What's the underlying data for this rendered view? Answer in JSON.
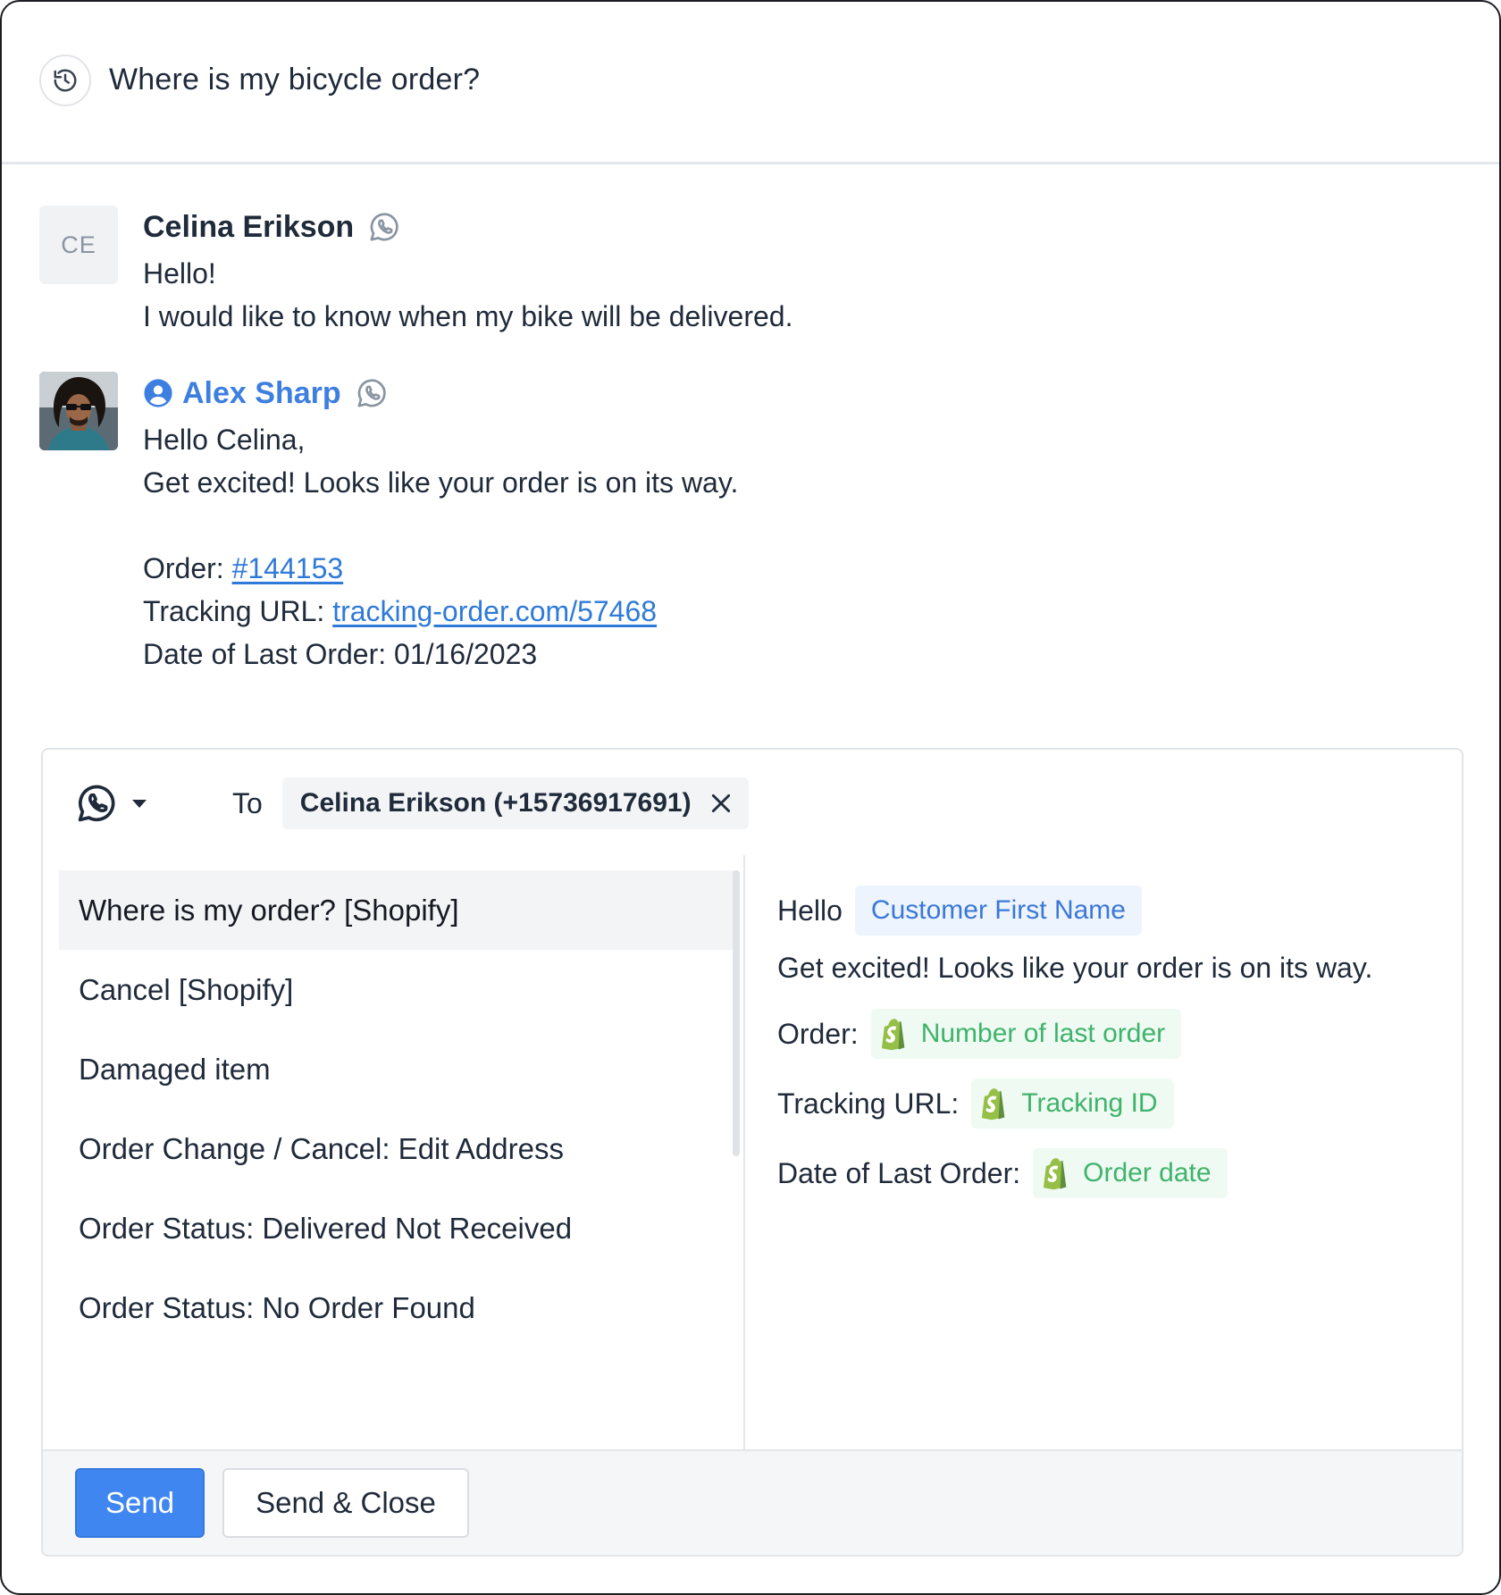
{
  "header": {
    "title": "Where is my bicycle order?",
    "icon": "history-icon"
  },
  "messages": [
    {
      "avatar_initials": "CE",
      "sender": "Celina Erikson",
      "channel_icon": "whatsapp-icon",
      "lines": [
        "Hello!",
        "I would like to know when my bike will be delivered."
      ]
    },
    {
      "sender": "Alex Sharp",
      "channel_icon": "whatsapp-icon",
      "lines": [
        "Hello Celina,",
        "Get excited! Looks like your order is on its way."
      ],
      "order_label": "Order: ",
      "order_link": "#144153",
      "tracking_label": "Tracking URL: ",
      "tracking_link": "tracking-order.com/57468",
      "date_line": "Date of Last Order: 01/16/2023"
    }
  ],
  "composer": {
    "channel_icon": "whatsapp-icon",
    "to_label": "To",
    "recipient": "Celina Erikson (+15736917691)",
    "templates": [
      "Where is my order? [Shopify]",
      "Cancel [Shopify]",
      "Damaged item",
      "Order Change / Cancel: Edit Address",
      "Order Status: Delivered Not Received",
      "Order Status: No Order Found"
    ],
    "selected_template_index": 0,
    "preview": {
      "greeting": "Hello",
      "greeting_var": "Customer First Name",
      "paragraph": "Get excited! Looks like your order is on its way.",
      "order_label": "Order:",
      "order_var": "Number of last order",
      "tracking_label": "Tracking URL:",
      "tracking_var": "Tracking ID",
      "date_label": "Date of Last Order:",
      "date_var": "Order date"
    },
    "send_label": "Send",
    "send_close_label": "Send & Close"
  },
  "colors": {
    "accent": "#3f86f0",
    "agent_name": "#3d7fe0",
    "link": "#2f7ad8",
    "shopify_var": "#3fb36b"
  }
}
